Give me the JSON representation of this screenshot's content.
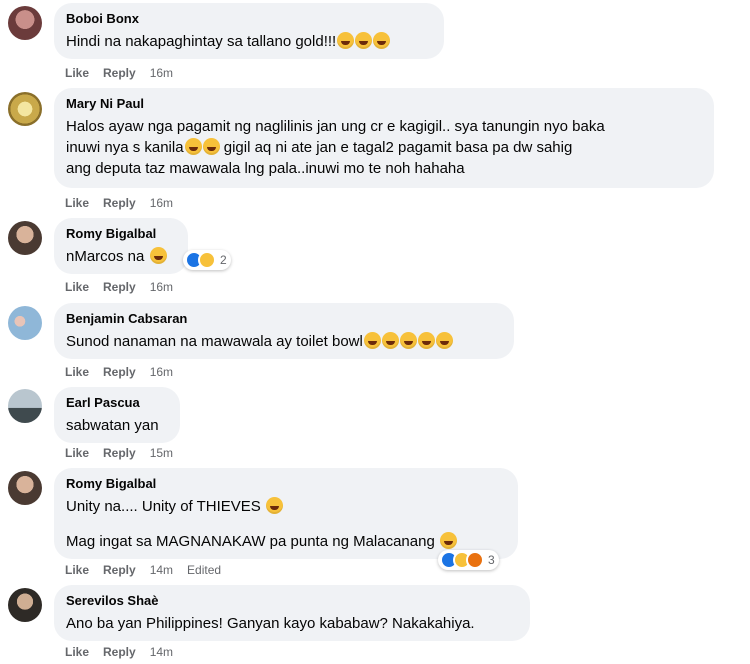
{
  "actions": {
    "like": "Like",
    "reply": "Reply"
  },
  "comments": [
    {
      "author": "Boboi Bonx",
      "lines": [
        "Hindi na nakapaghintay sa tallano gold!!!"
      ],
      "time": "16m"
    },
    {
      "author": "Mary Ni Paul",
      "lines": [
        "Halos ayaw nga pagamit ng naglilinis jan ung cr e kagigil.. sya tanungin nyo baka\ninuwi nya s kanila",
        " gigil aq ni ate jan e tagal2 pagamit basa pa dw sahig\nang deputa taz mawawala lng pala..inuwi mo te noh hahaha"
      ],
      "time": "16m"
    },
    {
      "author": "Romy Bigalbal",
      "lines": [
        "nMarcos na "
      ],
      "time": "16m",
      "reaction_count": "2"
    },
    {
      "author": "Benjamin Cabsaran",
      "lines": [
        "Sunod nanaman na mawawala ay toilet bowl"
      ],
      "time": "16m"
    },
    {
      "author": "Earl Pascua",
      "lines": [
        "sabwatan yan"
      ],
      "time": "15m"
    },
    {
      "author": "Romy Bigalbal",
      "lines": [
        "Unity na.... Unity of THIEVES ",
        "Mag ingat sa MAGNANAKAW pa punta ng Malacanang "
      ],
      "time": "14m",
      "edited": "Edited",
      "reaction_count": "3"
    },
    {
      "author": "Serevilos Shaè",
      "lines": [
        "Ano ba yan Philippines! Ganyan kayo kababaw? Nakakahiya."
      ],
      "time": "14m"
    }
  ]
}
